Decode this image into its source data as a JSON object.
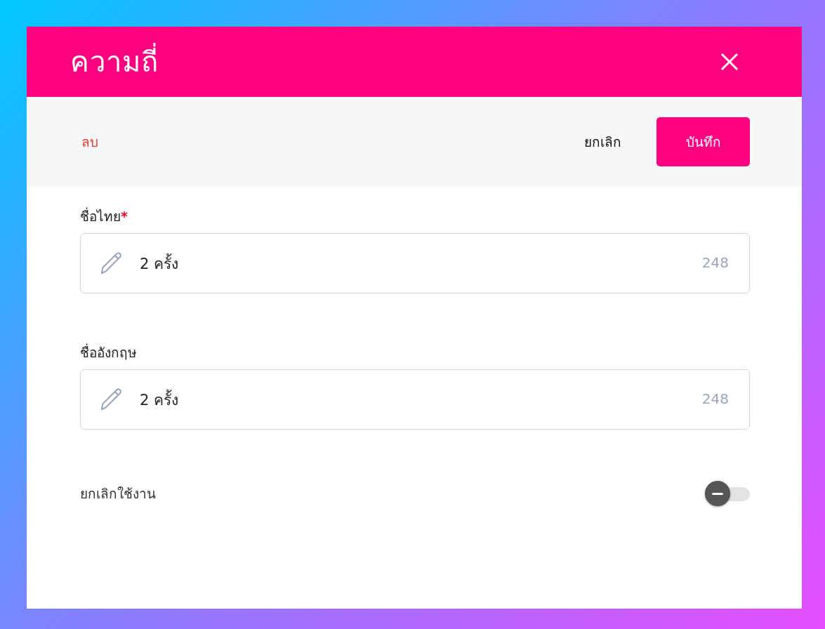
{
  "dialog": {
    "title": "ความถี่"
  },
  "toolbar": {
    "delete": "ลบ",
    "cancel": "ยกเลิก",
    "save": "บันทึก"
  },
  "fields": [
    {
      "label": "ชื่อไทย",
      "required_mark": "*",
      "value": "2 ครั้ง",
      "counter": "248"
    },
    {
      "label": "ชื่ออังกฤษ",
      "value": "2 ครั้ง",
      "counter": "248"
    }
  ],
  "toggle": {
    "label": "ยกเลิกใช้งาน",
    "on": false
  }
}
